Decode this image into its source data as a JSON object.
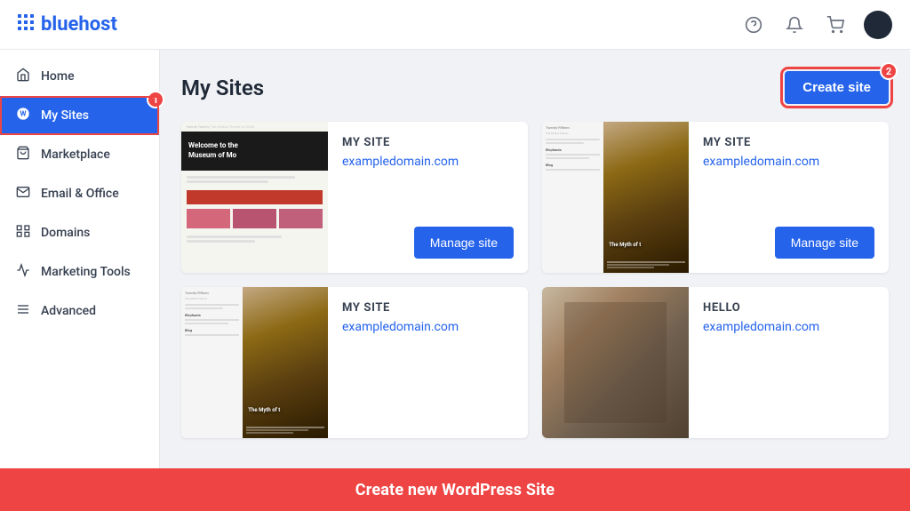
{
  "header": {
    "logo_text": "bluehost",
    "grid_icon": "⊞"
  },
  "sidebar": {
    "items": [
      {
        "id": "home",
        "label": "Home",
        "icon": "⌂",
        "active": false
      },
      {
        "id": "my-sites",
        "label": "My Sites",
        "icon": "W",
        "active": true,
        "badge": "1"
      },
      {
        "id": "marketplace",
        "label": "Marketplace",
        "icon": "🛍",
        "active": false
      },
      {
        "id": "email-office",
        "label": "Email & Office",
        "icon": "✉",
        "active": false
      },
      {
        "id": "domains",
        "label": "Domains",
        "icon": "⊞",
        "active": false
      },
      {
        "id": "marketing-tools",
        "label": "Marketing Tools",
        "icon": "📊",
        "active": false
      },
      {
        "id": "advanced",
        "label": "Advanced",
        "icon": "≡",
        "active": false
      }
    ]
  },
  "page": {
    "title": "My Sites",
    "create_site_label": "Create site",
    "create_site_badge": "2"
  },
  "sites": [
    {
      "id": "site1",
      "name": "MY SITE",
      "domain": "exampledomain.com",
      "manage_label": "Manage site",
      "thumb_type": "twenty-twenty"
    },
    {
      "id": "site2",
      "name": "MY SITE",
      "domain": "exampledomain.com",
      "manage_label": "Manage site",
      "thumb_type": "fifteen"
    },
    {
      "id": "site3",
      "name": "My Site",
      "domain": "exampledomain.com",
      "manage_label": "",
      "thumb_type": "fifteen"
    },
    {
      "id": "site4",
      "name": "Hello",
      "domain": "exampledomain.com",
      "manage_label": "",
      "thumb_type": "room"
    }
  ],
  "footer": {
    "label": "Create new WordPress Site"
  }
}
